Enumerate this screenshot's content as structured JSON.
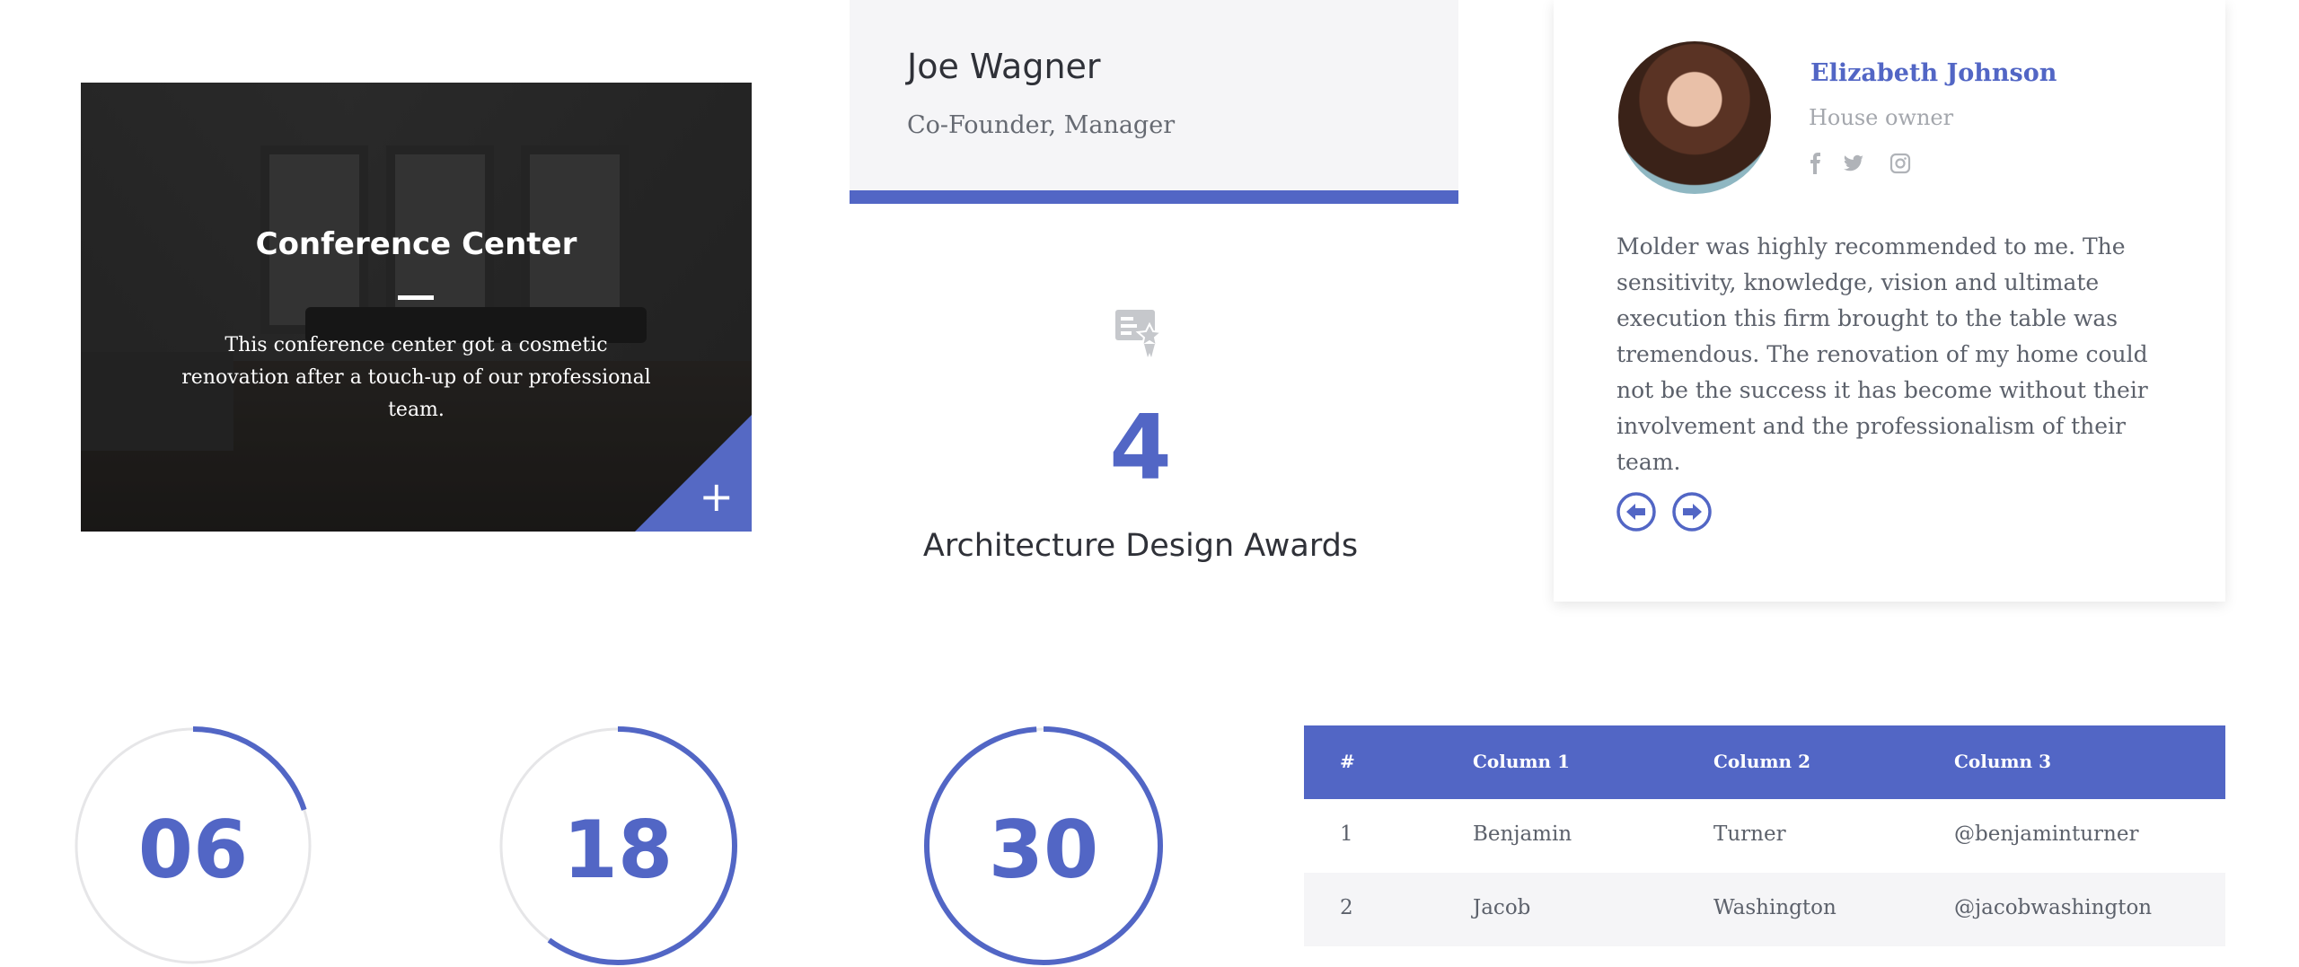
{
  "conference": {
    "title": "Conference Center",
    "description": "This conference center got a cosmetic renovation after a touch-up of our professional team.",
    "plus_glyph": "+"
  },
  "person": {
    "name": "Joe Wagner",
    "role": "Co-Founder, Manager"
  },
  "award": {
    "icon": "certificate-icon",
    "number": "4",
    "label": "Architecture Design Awards"
  },
  "testimonial": {
    "name": "Elizabeth Johnson",
    "role": "House owner",
    "quote": "Molder was highly recommended to me. The sensitivity, knowledge, vision and ultimate execution this firm brought to the table was tremendous. The renovation of my home could not be the success it has become without their involvement and the professionalism of their team.",
    "social_icons": [
      "facebook-icon",
      "twitter-icon",
      "instagram-icon"
    ]
  },
  "counters": [
    {
      "value": "06",
      "progress": 0.2
    },
    {
      "value": "18",
      "progress": 0.6
    },
    {
      "value": "30",
      "progress": 0.99
    }
  ],
  "table": {
    "headers": [
      "#",
      "Column 1",
      "Column 2",
      "Column 3"
    ],
    "rows": [
      [
        "1",
        "Benjamin",
        "Turner",
        "@benjaminturner"
      ],
      [
        "2",
        "Jacob",
        "Washington",
        "@jacobwashington"
      ]
    ]
  },
  "colors": {
    "accent": "#5266c5",
    "light_bg": "#f5f5f7",
    "text": "#555a66"
  }
}
